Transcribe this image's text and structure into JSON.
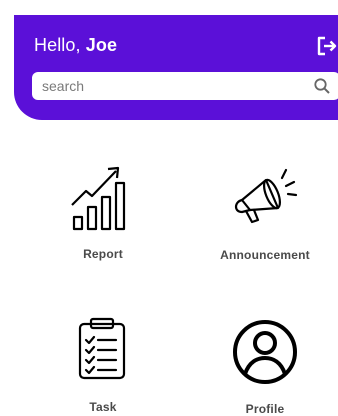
{
  "header": {
    "greeting_prefix": "Hello,",
    "user_name": "Joe",
    "accent_color": "#5b10d8"
  },
  "search": {
    "placeholder": "search",
    "value": ""
  },
  "menu": [
    {
      "label": "Report",
      "icon": "growth-chart-icon"
    },
    {
      "label": "Announcement",
      "icon": "megaphone-icon"
    },
    {
      "label": "Task",
      "icon": "clipboard-checklist-icon"
    },
    {
      "label": "Profile",
      "icon": "user-circle-icon"
    }
  ]
}
